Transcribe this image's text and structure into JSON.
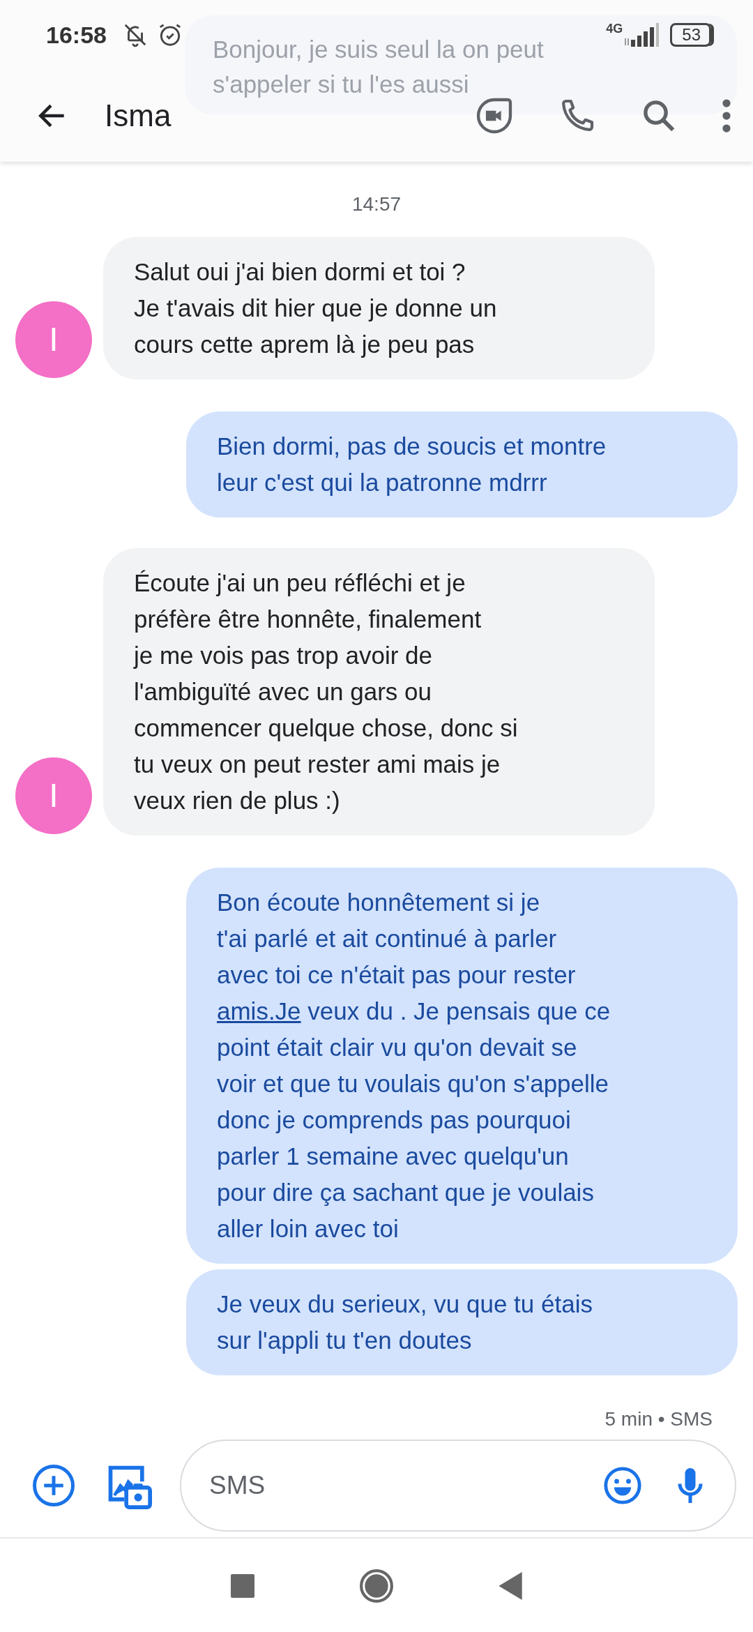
{
  "status_bar": {
    "time": "16:58",
    "network": "4G",
    "battery": "53"
  },
  "notification": {
    "text": "Bonjour, je suis seul la on peut\ns'appeler si tu l'es aussi"
  },
  "header": {
    "contact": "Isma"
  },
  "timestamp": "14:57",
  "messages": [
    {
      "kind": "received",
      "avatar": "I",
      "parts": [
        {
          "kind": "text",
          "text": "Salut oui j'ai bien dormi et toi ?\nJe t'avais dit hier que je donne un\ncours cette aprem là je peu pas"
        }
      ]
    },
    {
      "kind": "sent",
      "parts": [
        {
          "kind": "text",
          "text": "Bien dormi, pas de soucis et montre\nleur c'est qui la patronne mdrrr"
        }
      ]
    },
    {
      "kind": "received",
      "avatar": "I",
      "parts": [
        {
          "kind": "text",
          "text": "Écoute j'ai un peu réfléchi et je\npréfère être honnête, finalement\nje me vois pas trop avoir de\nl'ambiguïté avec un gars ou\ncommencer quelque chose, donc si\ntu veux on peut rester ami mais je\nveux rien de plus :)"
        }
      ]
    },
    {
      "kind": "sent",
      "parts": [
        {
          "kind": "text",
          "text": "Bon écoute honnêtement si je\nt'ai parlé et ait continué à parler\navec toi ce n'était pas pour rester\n"
        },
        {
          "kind": "link",
          "text": "amis.Je"
        },
        {
          "kind": "text",
          "text": " veux du . Je pensais que ce\npoint était clair vu qu'on devait se\nvoir et que tu voulais qu'on s'appelle\ndonc je comprends pas pourquoi\nparler 1 semaine avec quelqu'un\npour dire ça sachant que je voulais\naller loin avec toi"
        }
      ]
    },
    {
      "kind": "sent",
      "parts": [
        {
          "kind": "text",
          "text": "Je veux du serieux, vu que tu étais\nsur l'appli tu t'en doutes"
        }
      ]
    }
  ],
  "meta": "5 min • SMS",
  "composer": {
    "placeholder": "SMS"
  }
}
